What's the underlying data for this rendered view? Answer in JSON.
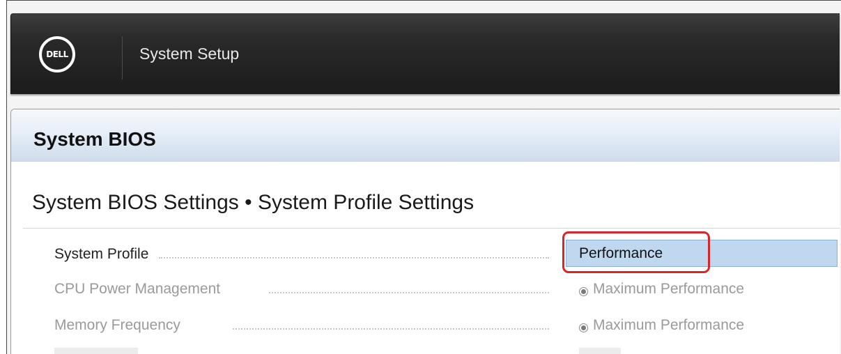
{
  "header": {
    "logo_text": "DELL",
    "title": "System Setup"
  },
  "panel": {
    "title": "System BIOS",
    "section_title": "System BIOS Settings • System Profile Settings"
  },
  "settings": [
    {
      "label": "System Profile",
      "value": "Performance",
      "control": "select",
      "enabled": true
    },
    {
      "label": "CPU Power Management",
      "value": "Maximum Performance",
      "control": "radio",
      "enabled": false
    },
    {
      "label": "Memory Frequency",
      "value": "Maximum Performance",
      "control": "radio",
      "enabled": false
    }
  ],
  "colors": {
    "header_bg": "#1c1c1c",
    "panel_title_bg": "#dbe6f2",
    "select_bg": "#c0d8ef",
    "highlight": "#d7262b",
    "disabled_text": "#9a9a9a"
  }
}
